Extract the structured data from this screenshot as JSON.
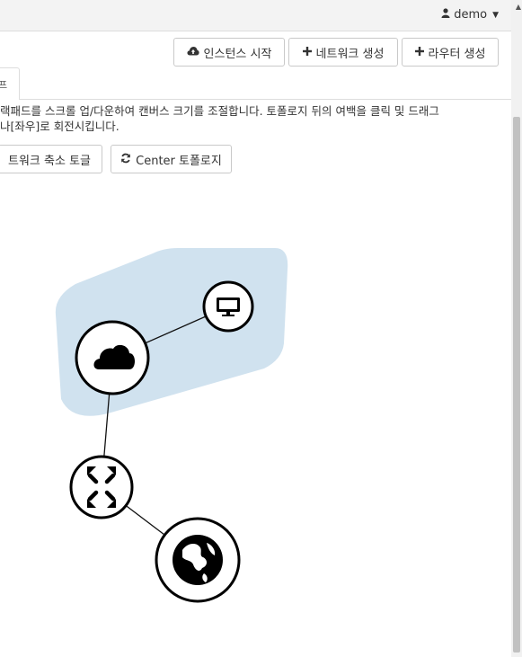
{
  "header": {
    "user": {
      "name": "demo"
    }
  },
  "toolbar": {
    "launch_instance_label": "인스턴스 시작",
    "create_network_label": "네트워크 생성",
    "create_router_label": "라우터 생성"
  },
  "tab": {
    "label": "프"
  },
  "help": {
    "line1": "랙패드를 스크롤 업/다운하여 캔버스 크기를 조절합니다. 토폴로지 뒤의 여백을 클릭 및 드래그",
    "line2": "나[좌우]로 회전시킵니다."
  },
  "controls": {
    "toggle_network_label": "트워크 축소 토글",
    "center_topology_label": "Center 토폴로지"
  },
  "topology": {
    "nodes": [
      "network",
      "instance",
      "router",
      "external-network"
    ],
    "network_color": "#d0e2ef"
  }
}
